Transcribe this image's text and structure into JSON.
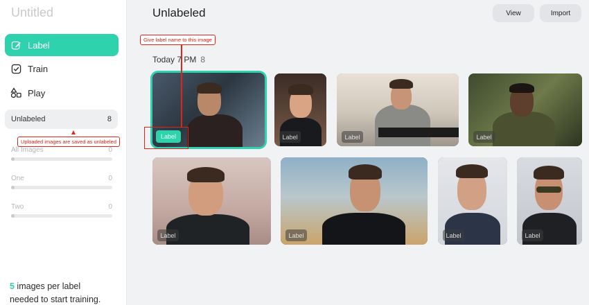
{
  "app": {
    "title": "Untitled"
  },
  "nav": [
    {
      "label": "Label",
      "icon": "edit-icon",
      "active": true
    },
    {
      "label": "Train",
      "icon": "check-square-icon",
      "active": false
    },
    {
      "label": "Play",
      "icon": "shapes-icon",
      "active": false
    }
  ],
  "categories": {
    "unlabeled": {
      "label": "Unlabeled",
      "count": "8"
    },
    "items": [
      {
        "label": "All Images",
        "count": "0"
      },
      {
        "label": "One",
        "count": "0"
      },
      {
        "label": "Two",
        "count": "0"
      }
    ]
  },
  "hint": {
    "number": "5",
    "text_line1": " images per label",
    "text_line2": "needed to start training."
  },
  "header": {
    "title": "Unlabeled",
    "view_label": "View",
    "import_label": "Import"
  },
  "group": {
    "title": "Today 7 PM",
    "count": "8"
  },
  "images": [
    {
      "label_chip": "Label",
      "selected": true
    },
    {
      "label_chip": "Label"
    },
    {
      "label_chip": "Label"
    },
    {
      "label_chip": "Label"
    },
    {
      "label_chip": "Label"
    },
    {
      "label_chip": "Label"
    },
    {
      "label_chip": "Label"
    },
    {
      "label_chip": "Label"
    }
  ],
  "annotations": {
    "give_label": "Give label name to this image",
    "uploaded_unlabeled": "Uploaded images are saved as unlabeled"
  },
  "colors": {
    "accent": "#2ed3ad",
    "annotation": "#e2231a"
  }
}
